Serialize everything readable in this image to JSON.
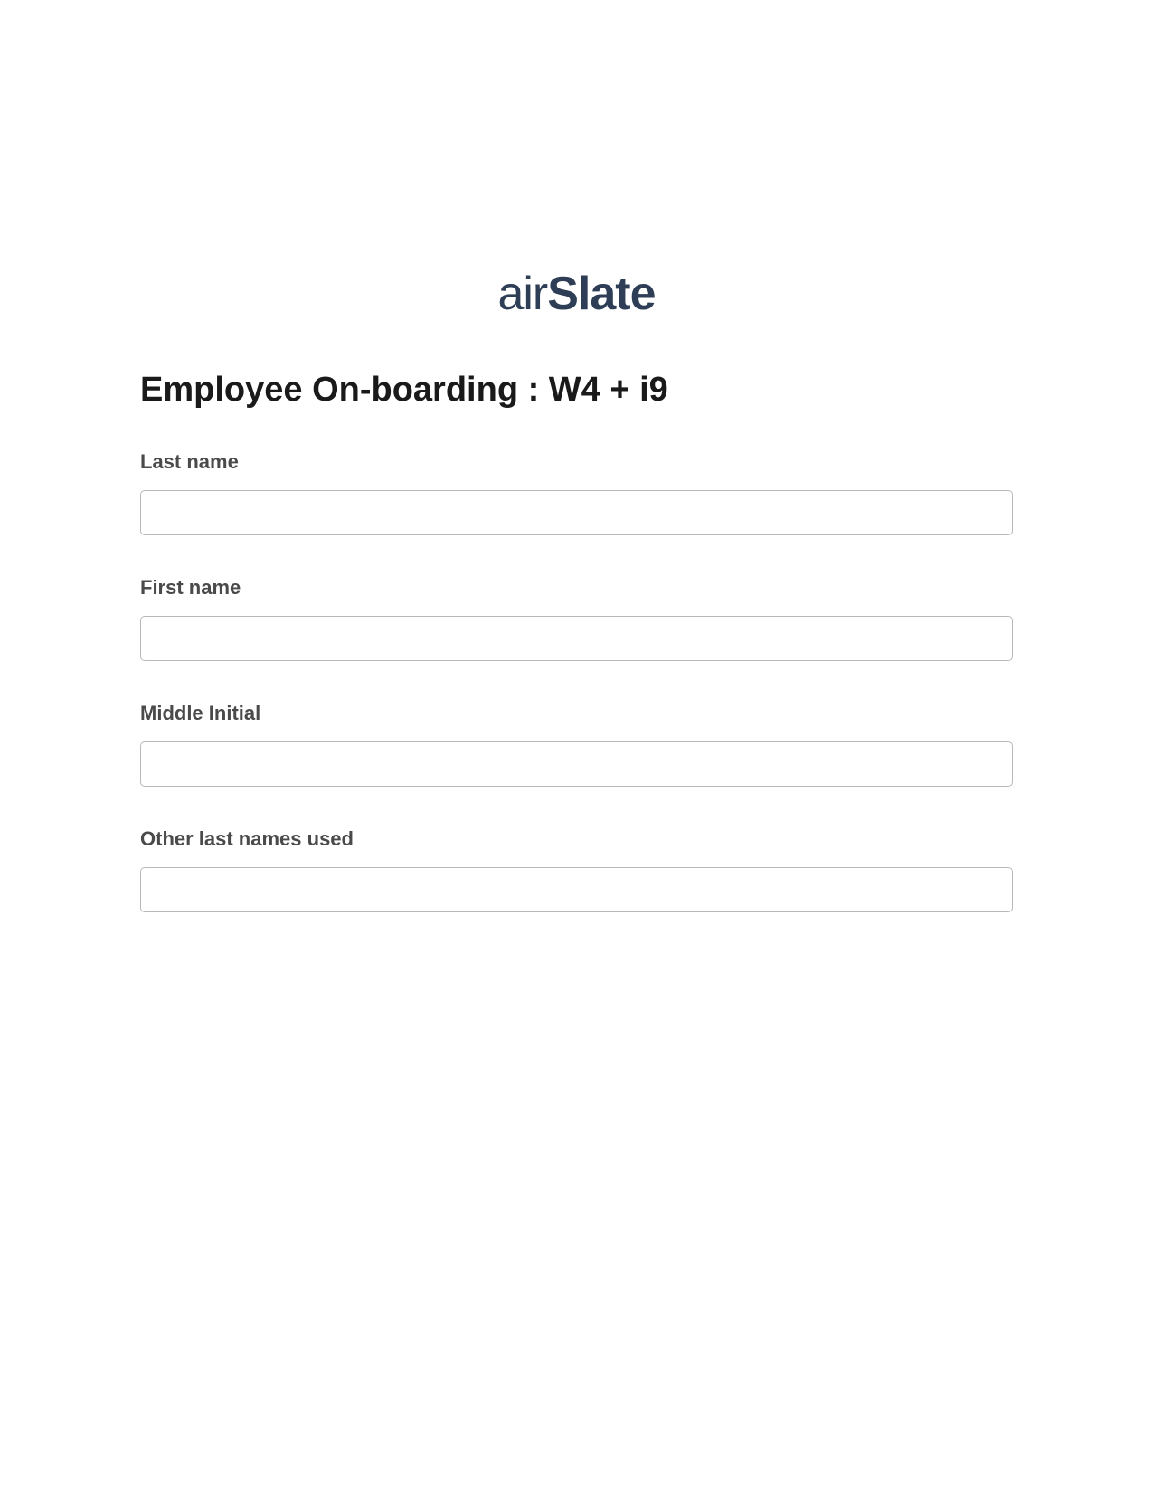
{
  "brand": {
    "name_part1": "air",
    "name_part2": "Slate"
  },
  "form": {
    "title": "Employee On-boarding : W4 + i9",
    "fields": {
      "last_name": {
        "label": "Last name",
        "value": ""
      },
      "first_name": {
        "label": "First name",
        "value": ""
      },
      "middle_initial": {
        "label": "Middle Initial",
        "value": ""
      },
      "other_last_names": {
        "label": "Other last names used",
        "value": ""
      }
    }
  }
}
